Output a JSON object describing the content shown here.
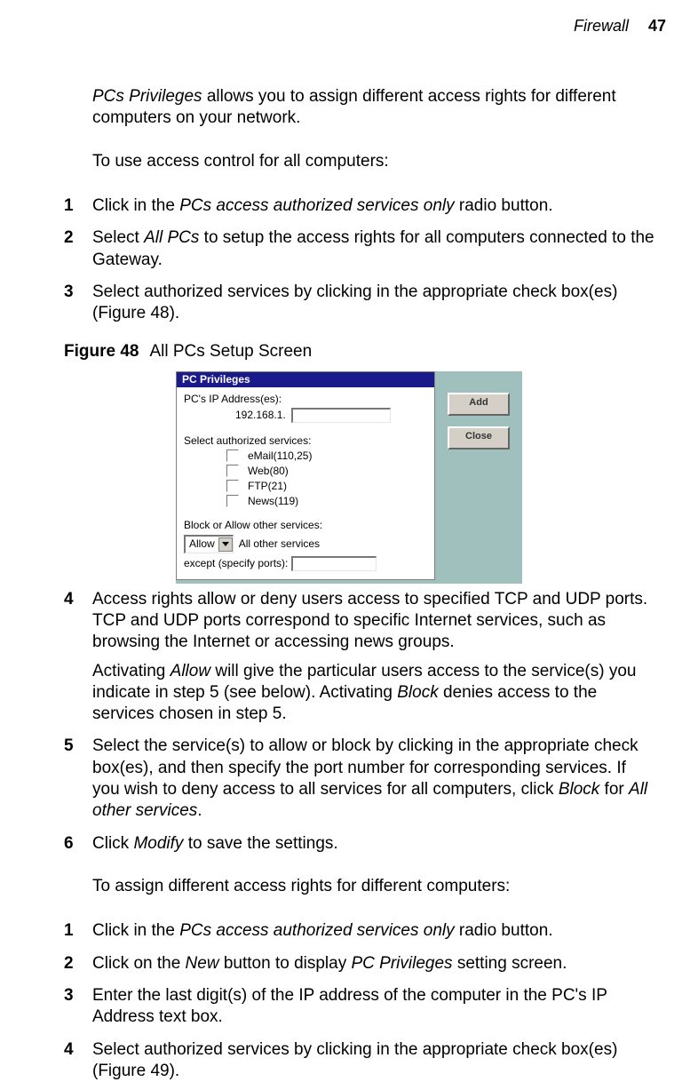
{
  "header": {
    "section": "Firewall",
    "page": "47"
  },
  "intro": {
    "lead": "PCs Privileges",
    "rest": " allows you to assign different access rights for different computers on your network."
  },
  "lead1": "To use access control for all computers:",
  "steps_a": [
    {
      "n": "1",
      "pre": "Click in the ",
      "em": "PCs access authorized services only",
      "post": " radio button."
    },
    {
      "n": "2",
      "pre": "Select ",
      "em": "All PCs",
      "post": " to setup the access rights for all computers connected to the Gateway."
    },
    {
      "n": "3",
      "pre": "Select authorized services by clicking in the appropriate check box(es) (Figure 48).",
      "em": "",
      "post": ""
    }
  ],
  "figure": {
    "label": "Figure 48",
    "caption": "All PCs Setup Screen"
  },
  "dialog": {
    "title": "PC Privileges",
    "ip_label": "PC's IP Address(es):",
    "ip_prefix": "192.168.1.",
    "svc_label": "Select authorized services:",
    "services": [
      "eMail(110,25)",
      "Web(80)",
      "FTP(21)",
      "News(119)"
    ],
    "block_label": "Block or Allow other services:",
    "select_value": "Allow",
    "block_rest": "All other services",
    "except_label": "except (specify ports):",
    "btn_add": "Add",
    "btn_close": "Close"
  },
  "step4a": {
    "n": "4",
    "p1": "Access rights allow or deny users access to specified TCP and UDP ports. TCP and UDP ports correspond to specific Internet services, such as browsing the Internet or accessing news groups.",
    "p2_pre": "Activating ",
    "p2_em1": "Allow",
    "p2_mid": " will give the particular users access to the service(s) you indicate in step 5 (see below). Activating ",
    "p2_em2": "Block",
    "p2_post": " denies access to the services chosen in step 5."
  },
  "step5": {
    "n": "5",
    "pre": "Select the service(s) to allow or block by clicking in the appropriate check box(es), and then specify the port number for corresponding services. If you wish to deny access to all services for all computers, click ",
    "em1": "Block",
    "mid": " for ",
    "em2": "All other services",
    "post": "."
  },
  "step6": {
    "n": "6",
    "pre": "Click ",
    "em": "Modify",
    "post": " to save the settings."
  },
  "lead2": "To assign different access rights for different computers:",
  "steps_b": [
    {
      "n": "1",
      "pre": "Click in the ",
      "em": "PCs access authorized services only",
      "post": " radio button."
    },
    {
      "n": "2",
      "pre": "Click on the ",
      "em": "New",
      "post": " button to display ",
      "em2": "PC Privileges",
      "post2": " setting screen."
    },
    {
      "n": "3",
      "pre": "Enter the last digit(s) of the IP address of the computer in the PC's IP Address text box.",
      "em": "",
      "post": ""
    },
    {
      "n": "4",
      "pre": "Select authorized services by clicking in the appropriate check box(es) (Figure 49).",
      "em": "",
      "post": ""
    }
  ]
}
